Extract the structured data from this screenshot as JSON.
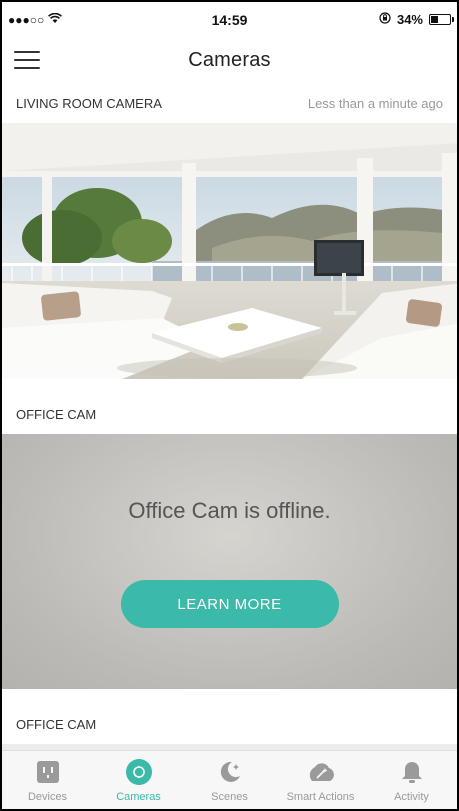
{
  "status_bar": {
    "signal": "●●●○○",
    "wifi_icon": "wifi-icon",
    "time": "14:59",
    "lock_icon": "orientation-lock-icon",
    "battery_percent": "34%",
    "battery_level": 0.34
  },
  "header": {
    "title": "Cameras",
    "menu_icon": "hamburger-menu-icon"
  },
  "cameras": [
    {
      "name": "LIVING ROOM CAMERA",
      "timestamp": "Less than a minute ago",
      "status": "online"
    },
    {
      "name": "OFFICE CAM",
      "status": "offline",
      "offline_message": "Office Cam is offline.",
      "action_label": "LEARN MORE"
    },
    {
      "name": "OFFICE CAM"
    }
  ],
  "tabs": [
    {
      "label": "Devices",
      "icon": "outlet-icon",
      "active": false
    },
    {
      "label": "Cameras",
      "icon": "camera-icon",
      "active": true
    },
    {
      "label": "Scenes",
      "icon": "moon-icon",
      "active": false
    },
    {
      "label": "Smart Actions",
      "icon": "magic-wand-icon",
      "active": false
    },
    {
      "label": "Activity",
      "icon": "bell-icon",
      "active": false
    }
  ],
  "colors": {
    "accent": "#3bb9a9",
    "tab_inactive": "#9a9a9a",
    "offline_bg": "#c4c2be"
  }
}
